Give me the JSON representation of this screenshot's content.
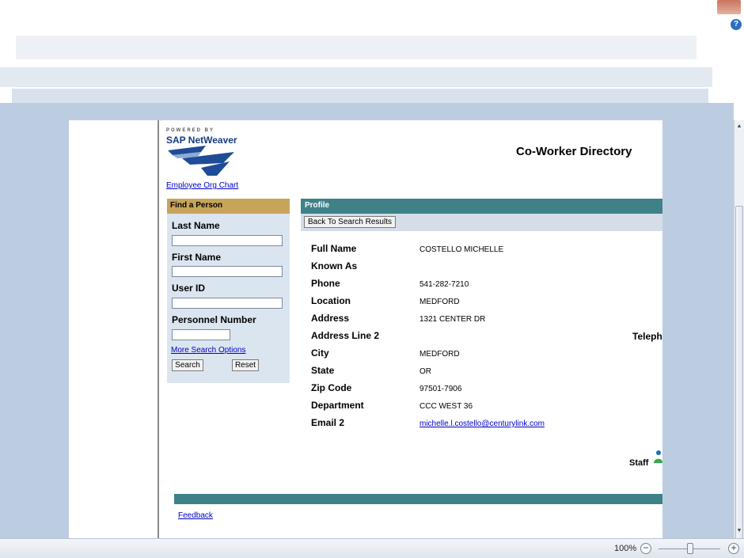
{
  "app": {
    "help_glyph": "?"
  },
  "sap": {
    "powered_by": "POWERED BY",
    "product_name": "SAP NetWeaver"
  },
  "header": {
    "org_chart_link": "Employee Org Chart",
    "title": "Co-Worker Directory"
  },
  "find_panel": {
    "title": "Find a Person",
    "last_name_label": "Last Name",
    "last_name_value": "",
    "first_name_label": "First Name",
    "first_name_value": "",
    "user_id_label": "User ID",
    "user_id_value": "",
    "personnel_number_label": "Personnel Number",
    "personnel_number_value": "",
    "more_options_link": "More Search Options",
    "search_button": "Search",
    "reset_button": "Reset"
  },
  "profile": {
    "title": "Profile",
    "back_button": "Back To Search Results",
    "rows": [
      {
        "label": "Full Name",
        "value": "COSTELLO MICHELLE"
      },
      {
        "label": "Known As",
        "value": ""
      },
      {
        "label": "Phone",
        "value": "541-282-7210"
      },
      {
        "label": "Location",
        "value": "MEDFORD"
      },
      {
        "label": "Address",
        "value": "1321 CENTER DR"
      },
      {
        "label": "Address Line 2",
        "value": ""
      },
      {
        "label": "City",
        "value": "MEDFORD"
      },
      {
        "label": "State",
        "value": "OR"
      },
      {
        "label": "Zip Code",
        "value": "97501-7906"
      },
      {
        "label": "Department",
        "value": "CCC WEST 36"
      },
      {
        "label": "Email 2",
        "value": "michelle.l.costello@centurylink.com"
      }
    ],
    "telephone_label_cut": "Teleph",
    "staff_label": "Staff"
  },
  "footer": {
    "feedback_link": "Feedback"
  },
  "statusbar": {
    "zoom_level": "100%",
    "zoom_minus": "−",
    "zoom_plus": "+",
    "zoom_fraction": 0.5
  },
  "colors": {
    "accent_teal": "#3e8288",
    "find_header": "#c8a45a",
    "panel_bg": "#dbe5f0",
    "workspace": "#bdcde1",
    "link": "#0000cc"
  }
}
